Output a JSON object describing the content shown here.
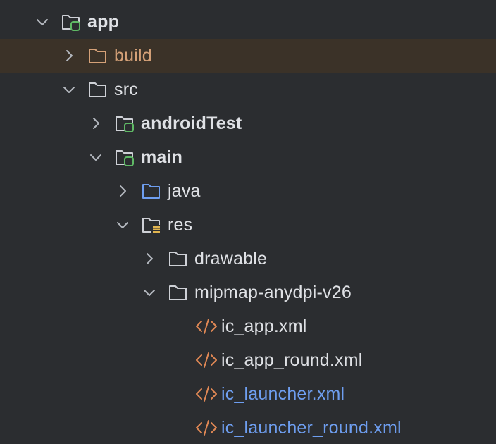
{
  "tree": {
    "app": {
      "label": "app",
      "expanded": true,
      "icon": "module-folder-icon"
    },
    "build": {
      "label": "build",
      "expanded": false,
      "icon": "excluded-folder-icon",
      "color": "#d5a178"
    },
    "src": {
      "label": "src",
      "expanded": true,
      "icon": "folder-icon"
    },
    "androidTest": {
      "label": "androidTest",
      "expanded": false,
      "icon": "module-folder-icon"
    },
    "main": {
      "label": "main",
      "expanded": true,
      "icon": "module-folder-icon"
    },
    "java": {
      "label": "java",
      "expanded": false,
      "icon": "source-folder-icon",
      "color": "#6e9ef0"
    },
    "res": {
      "label": "res",
      "expanded": true,
      "icon": "resources-folder-icon"
    },
    "drawable": {
      "label": "drawable",
      "expanded": false,
      "icon": "folder-icon"
    },
    "mipmap": {
      "label": "mipmap-anydpi-v26",
      "expanded": true,
      "icon": "folder-icon"
    },
    "files": [
      {
        "label": "ic_app.xml",
        "icon": "xml-file-icon"
      },
      {
        "label": "ic_app_round.xml",
        "icon": "xml-file-icon"
      },
      {
        "label": "ic_launcher.xml",
        "icon": "xml-file-icon",
        "modified": true
      },
      {
        "label": "ic_launcher_round.xml",
        "icon": "xml-file-icon",
        "modified": true
      }
    ]
  },
  "colors": {
    "background": "#2b2d30",
    "selected_row": "#3b3228",
    "text": "#dfe1e5",
    "excluded": "#d5a178",
    "modified": "#6e9ef0",
    "module_badge": "#5fb865",
    "xml_tag": "#e08855"
  }
}
